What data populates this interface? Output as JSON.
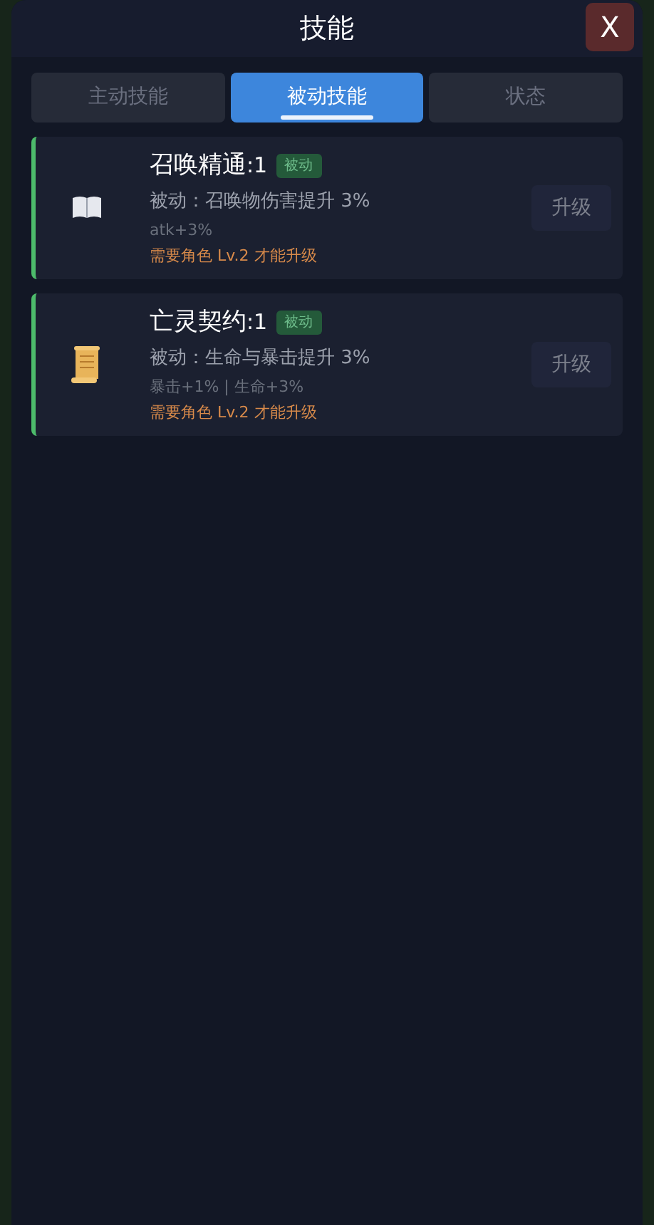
{
  "window": {
    "title": "技能",
    "close": "X"
  },
  "tabs": [
    {
      "label": "主动技能",
      "selected": false
    },
    {
      "label": "被动技能",
      "selected": true
    },
    {
      "label": "状态",
      "selected": false
    }
  ],
  "skills": [
    {
      "kind": "book",
      "name": "召唤精通",
      "rank": ":1",
      "badge": "被动",
      "effect": "被动：召唤物伤害提升 3%",
      "stats": "atk+3%",
      "requirement": "需要角色 Lv.2 才能升级",
      "upgrade": {
        "label": "升级",
        "disabled": true
      }
    },
    {
      "kind": "scroll",
      "name": "亡灵契约",
      "rank": ":1",
      "badge": "被动",
      "effect": "被动：生命与暴击提升 3%",
      "stats": "暴击+1% | 生命+3%",
      "requirement": "需要角色 Lv.2 才能升级",
      "upgrade": {
        "label": "升级",
        "disabled": true
      }
    }
  ]
}
